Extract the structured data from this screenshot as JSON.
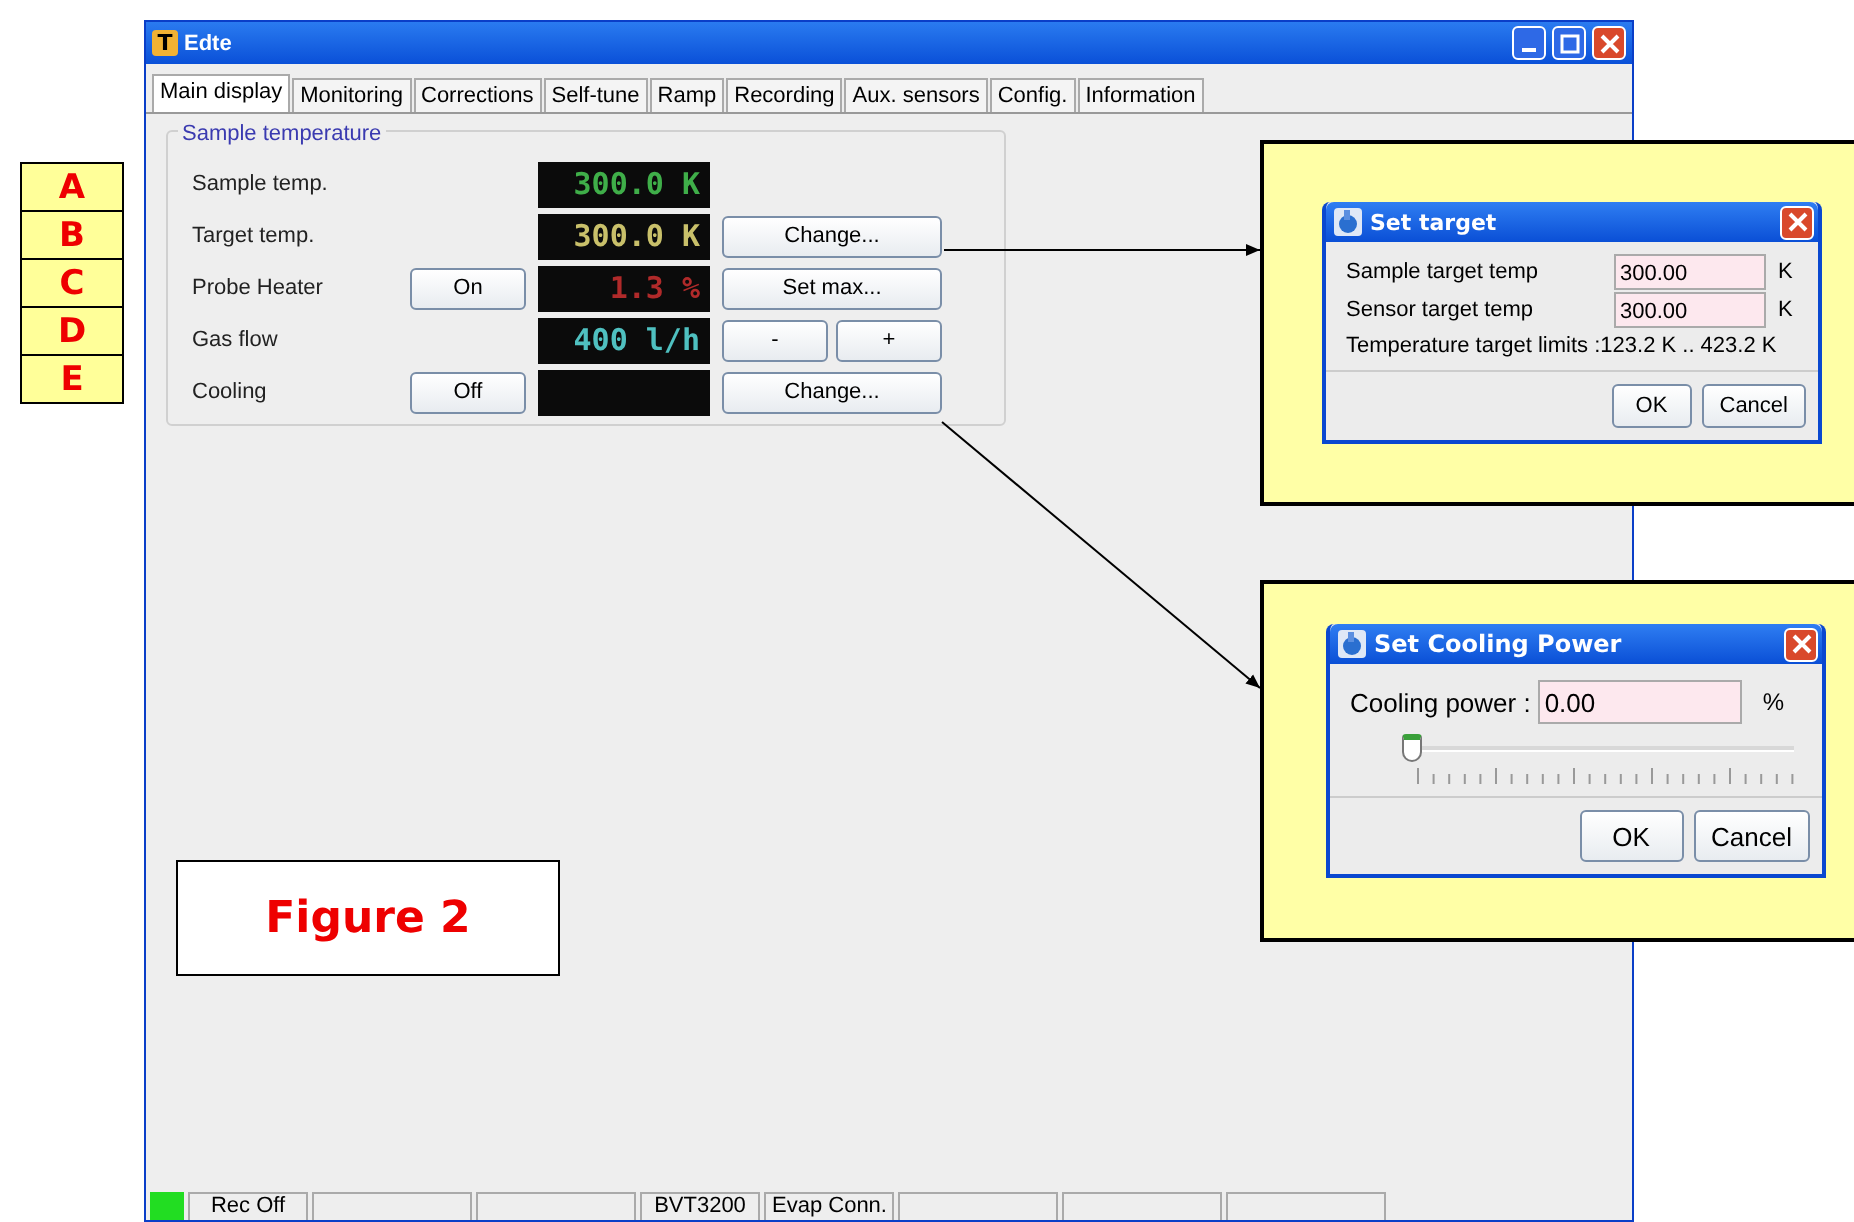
{
  "window": {
    "title": "Edte",
    "icon_letter": "T"
  },
  "tabs": [
    {
      "label": "Main display",
      "selected": true
    },
    {
      "label": "Monitoring",
      "selected": false
    },
    {
      "label": "Corrections",
      "selected": false
    },
    {
      "label": "Self-tune",
      "selected": false
    },
    {
      "label": "Ramp",
      "selected": false
    },
    {
      "label": "Recording",
      "selected": false
    },
    {
      "label": "Aux. sensors",
      "selected": false
    },
    {
      "label": "Config.",
      "selected": false
    },
    {
      "label": "Information",
      "selected": false
    }
  ],
  "group": {
    "title": "Sample temperature",
    "rows": [
      {
        "label": "Sample temp.",
        "display": "300.0 K",
        "color": "#3fae49"
      },
      {
        "label": "Target temp.",
        "display": "300.0 K",
        "color": "#c9c06a",
        "actions": [
          "Change..."
        ]
      },
      {
        "label": "Probe Heater",
        "toggle": "On",
        "display": "1.3 %",
        "color": "#b02a2a",
        "actions": [
          "Set max..."
        ]
      },
      {
        "label": "Gas flow",
        "display": "400 l/h",
        "color": "#4fc0c0",
        "actions": [
          "-",
          "+"
        ]
      },
      {
        "label": "Cooling",
        "toggle": "Off",
        "actions": [
          "Change..."
        ]
      }
    ]
  },
  "row_markers": [
    "A",
    "B",
    "C",
    "D",
    "E"
  ],
  "figure_label": "Figure 2",
  "status_bar": [
    {
      "kind": "indicator",
      "on": true
    },
    {
      "kind": "text",
      "text": "Rec Off"
    },
    {
      "kind": "blank"
    },
    {
      "kind": "blank"
    },
    {
      "kind": "text",
      "text": "BVT3200"
    },
    {
      "kind": "text",
      "text": "Evap Conn."
    },
    {
      "kind": "blank"
    },
    {
      "kind": "blank"
    },
    {
      "kind": "blank"
    }
  ],
  "callouts": [
    {
      "kind": "form",
      "title": "Set target",
      "fields": [
        {
          "label": "Sample target temp",
          "value": "300.00",
          "unit": "K"
        },
        {
          "label": "Sensor target temp",
          "value": "300.00",
          "unit": "K"
        }
      ],
      "note": "Temperature target limits :123.2 K .. 423.2 K",
      "buttons": [
        "OK",
        "Cancel"
      ]
    },
    {
      "kind": "slider",
      "title": "Set Cooling Power",
      "fields": [
        {
          "label": "Cooling power :",
          "value": "0.00",
          "unit": "%"
        }
      ],
      "level": 0,
      "buttons": [
        "OK",
        "Cancel"
      ]
    }
  ]
}
